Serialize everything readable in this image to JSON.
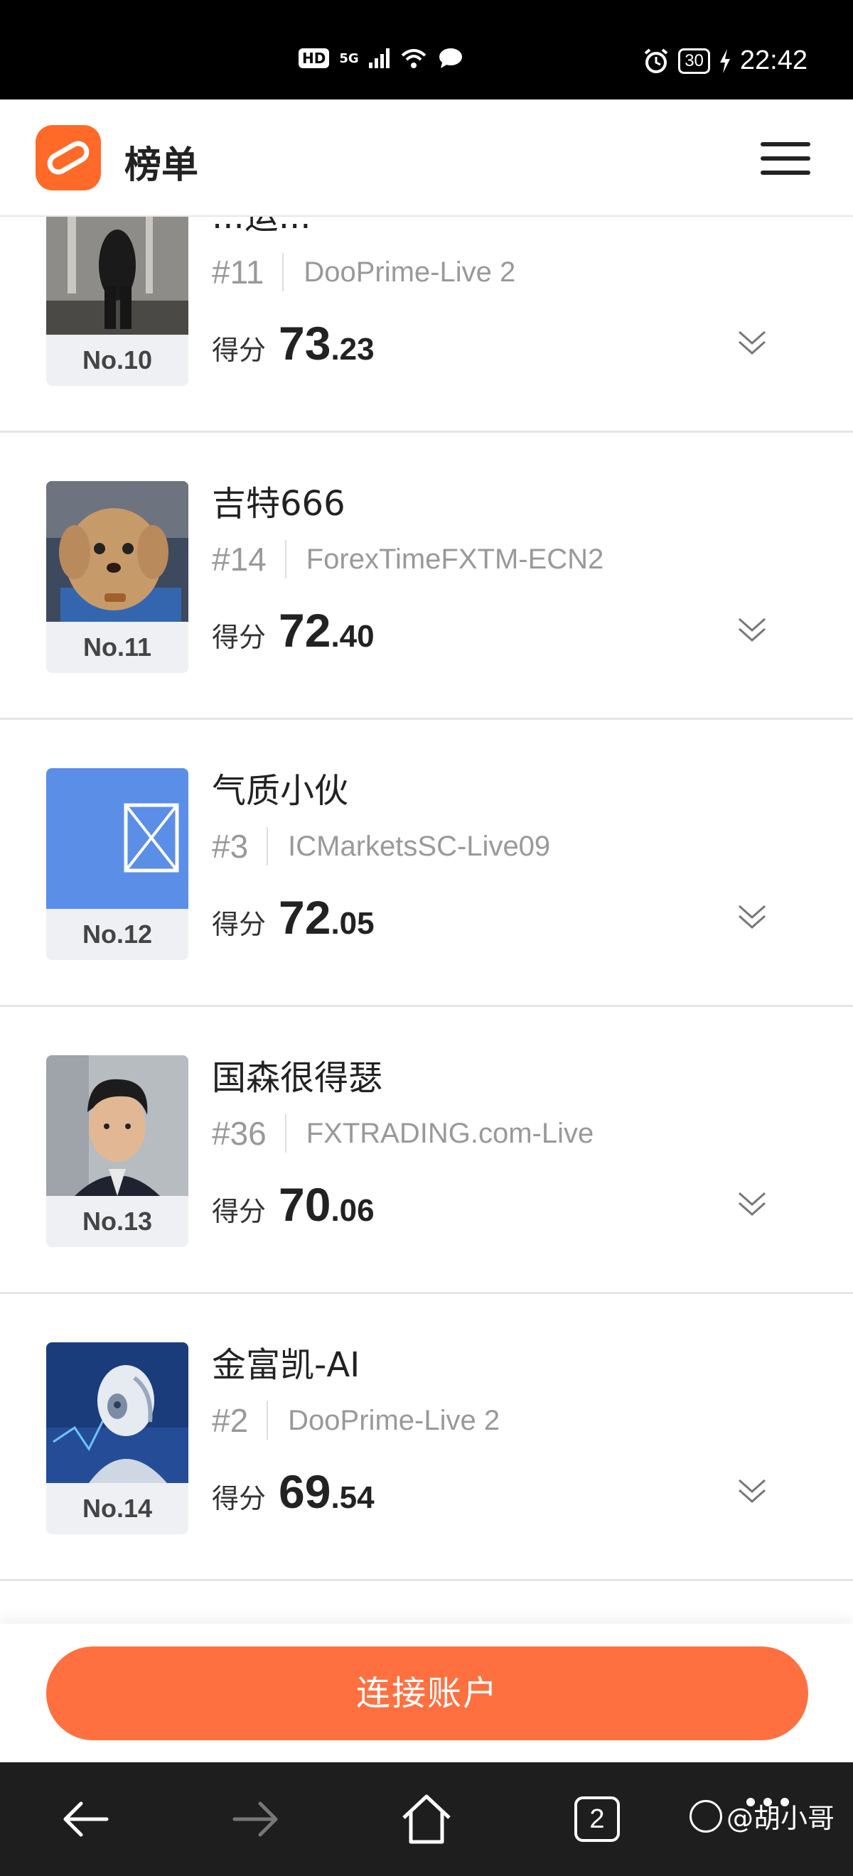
{
  "status_bar": {
    "network": "5G",
    "hd": "HD",
    "battery": "30",
    "time": "22:42"
  },
  "header": {
    "title": "榜单"
  },
  "ranking": [
    {
      "no": "No.10",
      "name": "...运...",
      "rank": "#11",
      "server": "DooPrime-Live 2",
      "score_label": "得分",
      "score_int": "73",
      "score_dec": ".23"
    },
    {
      "no": "No.11",
      "name": "吉特666",
      "rank": "#14",
      "server": "ForexTimeFXTM-ECN2",
      "score_label": "得分",
      "score_int": "72",
      "score_dec": ".40"
    },
    {
      "no": "No.12",
      "name": "气质小伙",
      "rank": "#3",
      "server": "ICMarketsSC-Live09",
      "score_label": "得分",
      "score_int": "72",
      "score_dec": ".05"
    },
    {
      "no": "No.13",
      "name": "国森很得瑟",
      "rank": "#36",
      "server": "FXTRADING.com-Live",
      "score_label": "得分",
      "score_int": "70",
      "score_dec": ".06"
    },
    {
      "no": "No.14",
      "name": "金富凯-AI",
      "rank": "#2",
      "server": "DooPrime-Live 2",
      "score_label": "得分",
      "score_int": "69",
      "score_dec": ".54"
    }
  ],
  "cta": {
    "connect_label": "连接账户"
  },
  "nav": {
    "tab_count": "2"
  },
  "watermark": {
    "text": "@胡小哥"
  },
  "colors": {
    "brand_orange": "#ff6a28",
    "cta_orange": "#ff7040",
    "placeholder_blue": "#5b8ee6"
  }
}
